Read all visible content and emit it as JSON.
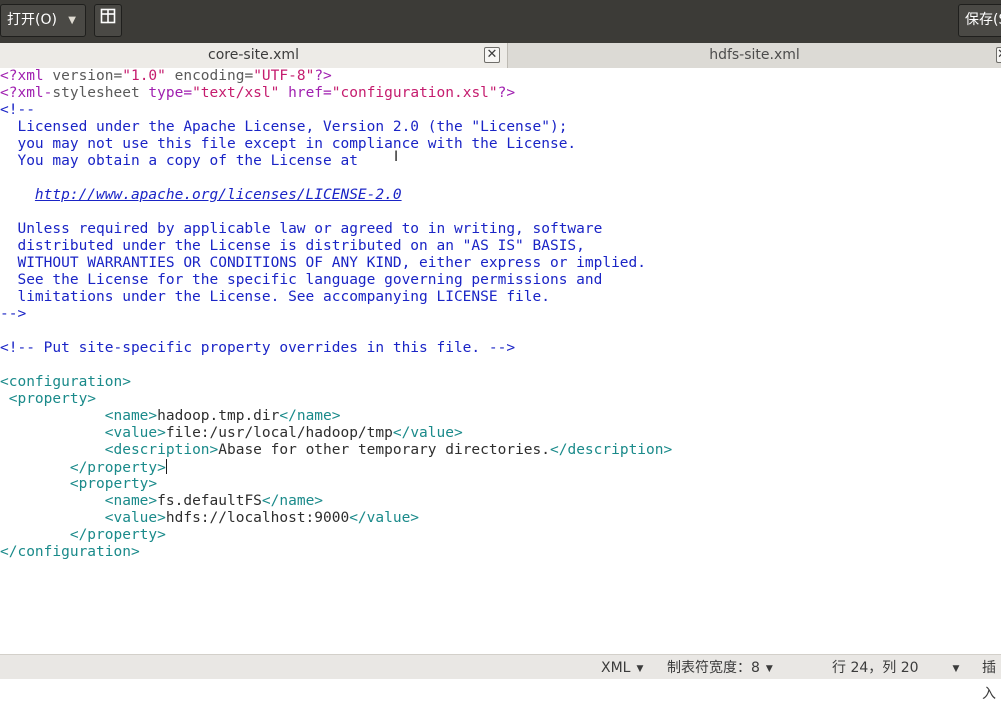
{
  "header": {
    "open_label": "打开(O)",
    "new_tab_icon": "new-tab-icon",
    "save_label": "保存(S"
  },
  "tabs": [
    {
      "label": "core-site.xml",
      "close": "✕"
    },
    {
      "label": "hdfs-site.xml",
      "close": "✕"
    }
  ],
  "editor": {
    "lines": [
      [
        [
          "pi",
          "<?xml "
        ],
        [
          "pia",
          "version="
        ],
        [
          "piv",
          "\"1.0\""
        ],
        [
          "pia",
          " encoding="
        ],
        [
          "piv",
          "\"UTF-8\""
        ],
        [
          "pi",
          "?>"
        ]
      ],
      [
        [
          "pi",
          "<?xml-"
        ],
        [
          "pia",
          "stylesheet "
        ],
        [
          "pi",
          "type="
        ],
        [
          "piv",
          "\"text/xsl\""
        ],
        [
          "pi",
          " href="
        ],
        [
          "piv",
          "\"configuration.xsl\""
        ],
        [
          "pi",
          "?>"
        ]
      ],
      [
        [
          "comment",
          "<!--"
        ]
      ],
      [
        [
          "comment",
          "  Licensed under the Apache License, Version 2.0 (the \"License\");"
        ]
      ],
      [
        [
          "comment",
          "  you may not use this file except in compliance with the License."
        ]
      ],
      [
        [
          "comment",
          "  You may obtain a copy of the License at"
        ]
      ],
      [
        [
          "comment",
          ""
        ]
      ],
      [
        [
          "comment",
          "    "
        ],
        [
          "comment-url",
          "http://www.apache.org/licenses/LICENSE-2.0"
        ]
      ],
      [
        [
          "comment",
          ""
        ]
      ],
      [
        [
          "comment",
          "  Unless required by applicable law or agreed to in writing, software"
        ]
      ],
      [
        [
          "comment",
          "  distributed under the License is distributed on an \"AS IS\" BASIS,"
        ]
      ],
      [
        [
          "comment",
          "  WITHOUT WARRANTIES OR CONDITIONS OF ANY KIND, either express or implied."
        ]
      ],
      [
        [
          "comment",
          "  See the License for the specific language governing permissions and"
        ]
      ],
      [
        [
          "comment",
          "  limitations under the License. See accompanying LICENSE file."
        ]
      ],
      [
        [
          "comment",
          "-->"
        ]
      ],
      [
        [
          "text",
          ""
        ]
      ],
      [
        [
          "comment",
          "<!-- Put site-specific property overrides in this file. -->"
        ]
      ],
      [
        [
          "text",
          ""
        ]
      ],
      [
        [
          "tag",
          "<configuration>"
        ]
      ],
      [
        [
          "tag",
          " <property>"
        ]
      ],
      [
        [
          "text",
          "            "
        ],
        [
          "tag",
          "<name>"
        ],
        [
          "text",
          "hadoop.tmp.dir"
        ],
        [
          "tag",
          "</name>"
        ]
      ],
      [
        [
          "text",
          "            "
        ],
        [
          "tag",
          "<value>"
        ],
        [
          "text",
          "file:/usr/local/hadoop/tmp"
        ],
        [
          "tag",
          "</value>"
        ]
      ],
      [
        [
          "text",
          "            "
        ],
        [
          "tag",
          "<description>"
        ],
        [
          "text",
          "Abase for other temporary directories."
        ],
        [
          "tag",
          "</description>"
        ]
      ],
      [
        [
          "text",
          "        "
        ],
        [
          "tag",
          "</property>"
        ],
        [
          "caret",
          ""
        ]
      ],
      [
        [
          "text",
          "        "
        ],
        [
          "tag",
          "<property>"
        ]
      ],
      [
        [
          "text",
          "            "
        ],
        [
          "tag",
          "<name>"
        ],
        [
          "text",
          "fs.defaultFS"
        ],
        [
          "tag",
          "</name>"
        ]
      ],
      [
        [
          "text",
          "            "
        ],
        [
          "tag",
          "<value>"
        ],
        [
          "text",
          "hdfs://localhost:9000"
        ],
        [
          "tag",
          "</value>"
        ]
      ],
      [
        [
          "text",
          "        "
        ],
        [
          "tag",
          "</property>"
        ]
      ],
      [
        [
          "tag",
          "</configuration>"
        ]
      ]
    ]
  },
  "status": {
    "language": "XML",
    "tab_width": "制表符宽度：8",
    "position": "行 24，列 20",
    "insert_mode": "插入"
  },
  "colors": {
    "header_bg": "#3c3b37",
    "comment": "#1a24c6",
    "tag": "#1a8a8a",
    "processing_instruction": "#a020b0",
    "attribute_value": "#c51c6e"
  }
}
